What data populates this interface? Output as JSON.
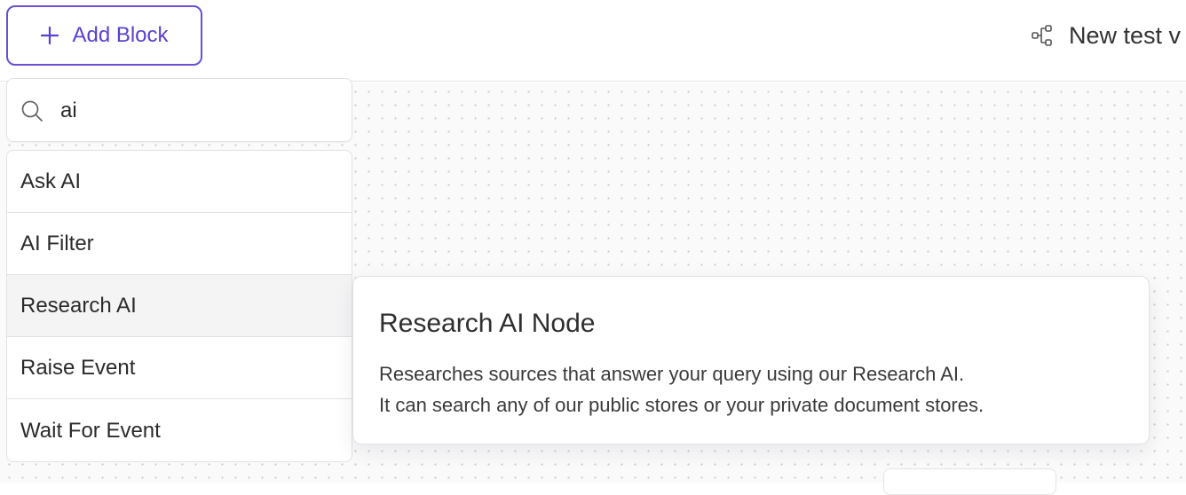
{
  "toolbar": {
    "add_block_label": "Add Block",
    "workflow_title": "New test v"
  },
  "search": {
    "value": "ai",
    "icon": "search-icon"
  },
  "results": [
    {
      "label": "Ask AI"
    },
    {
      "label": "AI Filter"
    },
    {
      "label": "Research AI",
      "hovered": true
    },
    {
      "label": "Raise Event"
    },
    {
      "label": "Wait For Event"
    }
  ],
  "tooltip": {
    "title": "Research AI Node",
    "line1": "Researches sources that answer your query using our Research AI.",
    "line2": "It can search any of our public stores or your private document stores."
  },
  "colors": {
    "accent": "#5b3fd0",
    "accent_border": "#6b4fd8",
    "hover_bg": "#f4f4f5"
  }
}
